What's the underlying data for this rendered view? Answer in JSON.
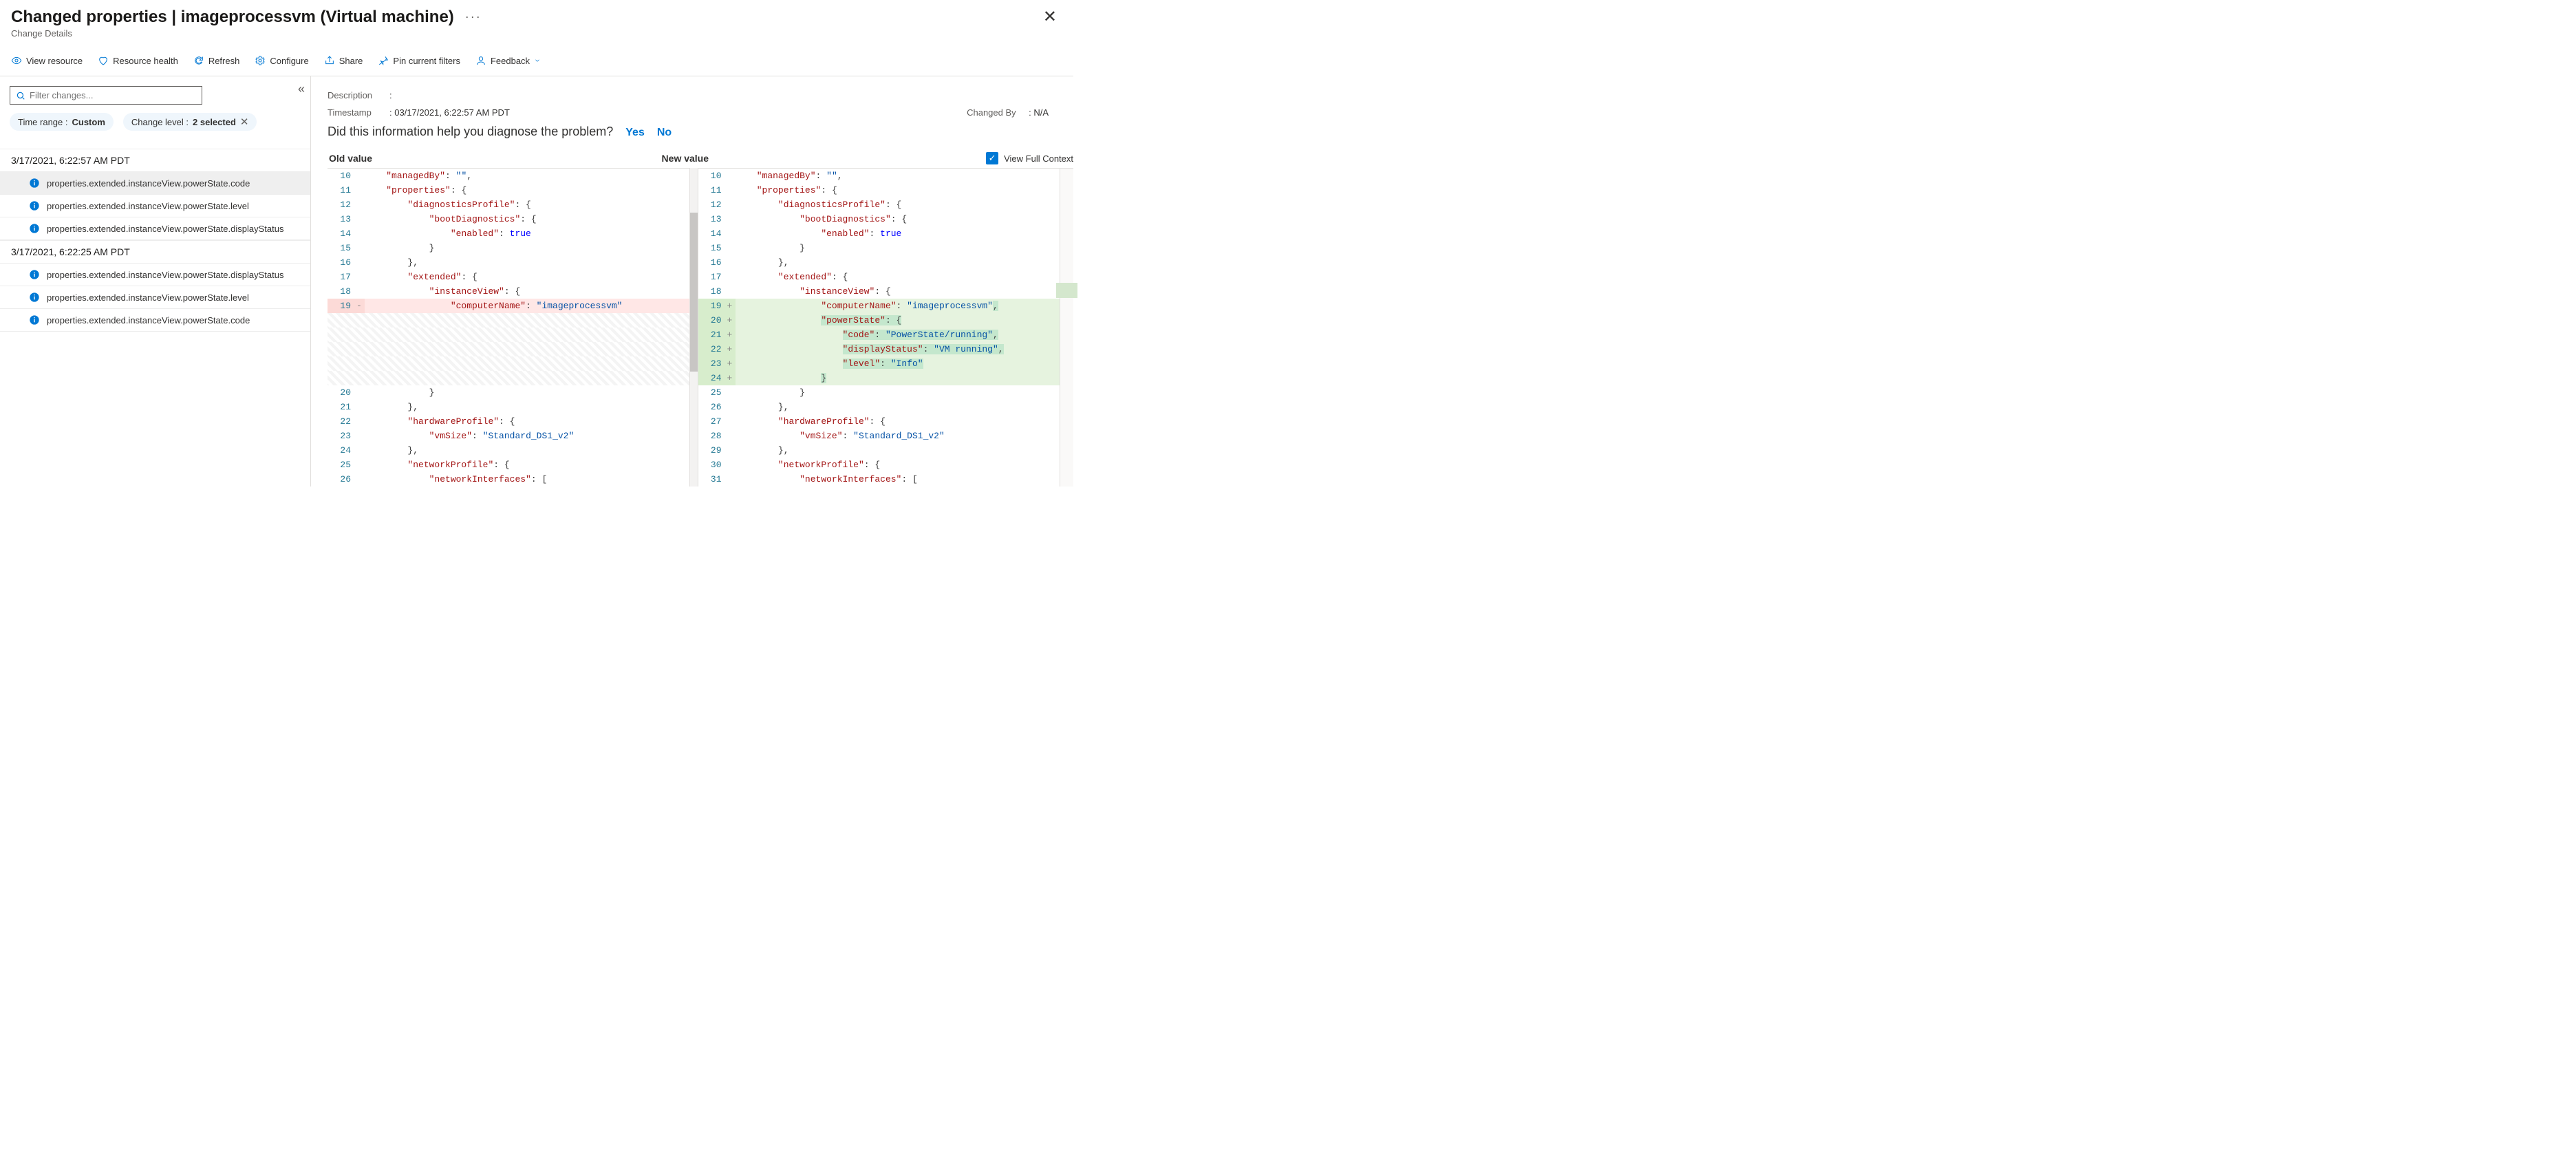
{
  "header": {
    "title": "Changed properties | imageprocessvm (Virtual machine)",
    "subtitle": "Change Details"
  },
  "toolbar": {
    "view_resource": "View resource",
    "resource_health": "Resource health",
    "refresh": "Refresh",
    "configure": "Configure",
    "share": "Share",
    "pin": "Pin current filters",
    "feedback": "Feedback"
  },
  "filter": {
    "placeholder": "Filter changes..."
  },
  "chips": {
    "range_label": "Time range : ",
    "range_value": "Custom",
    "level_label": "Change level : ",
    "level_value": "2 selected"
  },
  "groups": [
    {
      "ts": "3/17/2021, 6:22:57 AM PDT",
      "items": [
        "properties.extended.instanceView.powerState.code",
        "properties.extended.instanceView.powerState.level",
        "properties.extended.instanceView.powerState.displayStatus"
      ]
    },
    {
      "ts": "3/17/2021, 6:22:25 AM PDT",
      "items": [
        "properties.extended.instanceView.powerState.displayStatus",
        "properties.extended.instanceView.powerState.level",
        "properties.extended.instanceView.powerState.code"
      ]
    }
  ],
  "meta": {
    "desc_k": "Description",
    "desc_v": ":",
    "ts_k": "Timestamp",
    "ts_v": ":  03/17/2021, 6:22:57 AM PDT",
    "by_k": "Changed By",
    "by_v": ":  N/A"
  },
  "question": {
    "text": "Did this information help you diagnose the problem?",
    "yes": "Yes",
    "no": "No"
  },
  "diff": {
    "old_h": "Old value",
    "new_h": "New value",
    "ctx": "View Full Context"
  },
  "code": {
    "managedBy": "managedBy",
    "properties": "properties",
    "diag": "diagnosticsProfile",
    "boot": "bootDiagnostics",
    "enabled": "enabled",
    "true": "true",
    "extended": "extended",
    "instanceView": "instanceView",
    "computerName": "computerName",
    "vm": "imageprocessvm",
    "powerState": "powerState",
    "code": "code",
    "codeVal": "PowerState/running",
    "dispStatus": "displayStatus",
    "dispVal": "VM running",
    "level": "level",
    "levelVal": "Info",
    "hw": "hardwareProfile",
    "vmSize": "vmSize",
    "vmSizeVal": "Standard_DS1_v2",
    "np": "networkProfile",
    "ni": "networkInterfaces"
  }
}
